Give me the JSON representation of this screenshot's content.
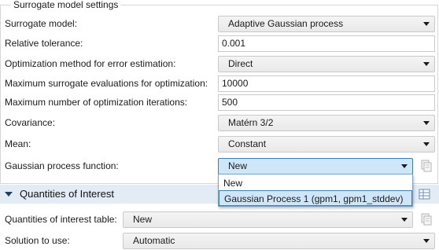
{
  "group": {
    "title": "Surrogate model settings"
  },
  "rows": {
    "surrogate_model": {
      "label": "Surrogate model:",
      "value": "Adaptive Gaussian process"
    },
    "relative_tolerance": {
      "label": "Relative tolerance:",
      "value": "0.001"
    },
    "optimization_method": {
      "label": "Optimization method for error estimation:",
      "value": "Direct"
    },
    "max_surrogate_evals": {
      "label": "Maximum surrogate evaluations for optimization:",
      "value": "10000"
    },
    "max_iterations": {
      "label": "Maximum number of optimization iterations:",
      "value": "500"
    },
    "covariance": {
      "label": "Covariance:",
      "value": "Matérn 3/2"
    },
    "mean": {
      "label": "Mean:",
      "value": "Constant"
    },
    "gp_function": {
      "label": "Gaussian process function:",
      "value": "New"
    }
  },
  "dropdown": {
    "options": [
      "New",
      "Gaussian Process 1 (gpm1, gpm1_stddev)"
    ],
    "highlighted": "Gaussian Process 1 (gpm1, gpm1_stddev)"
  },
  "section": {
    "title": "Quantities of Interest"
  },
  "qoi": {
    "table": {
      "label": "Quantities of interest table:",
      "value": "New"
    },
    "solution": {
      "label": "Solution to use:",
      "value": "Automatic"
    }
  },
  "icons": {
    "gp_side": "copy-settings-icon",
    "section_side": "table-icon",
    "qoi_side": "copy-settings-icon"
  },
  "colors": {
    "section_bar": "#e3ebf4",
    "active_combo": "#cfe6f8",
    "active_border": "#3c7fb1"
  }
}
